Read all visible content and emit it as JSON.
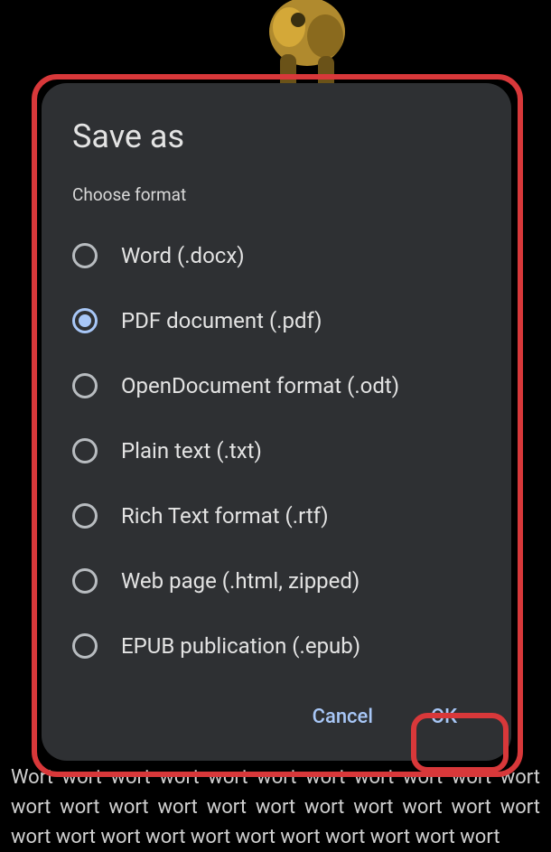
{
  "dialog": {
    "title": "Save as",
    "subtitle": "Choose format",
    "options": [
      {
        "label": "Word (.docx)",
        "selected": false
      },
      {
        "label": "PDF document (.pdf)",
        "selected": true
      },
      {
        "label": "OpenDocument format (.odt)",
        "selected": false
      },
      {
        "label": "Plain text (.txt)",
        "selected": false
      },
      {
        "label": "Rich Text format (.rtf)",
        "selected": false
      },
      {
        "label": "Web page (.html, zipped)",
        "selected": false
      },
      {
        "label": "EPUB publication (.epub)",
        "selected": false
      }
    ],
    "actions": {
      "cancel": "Cancel",
      "ok": "OK"
    }
  },
  "background_text": "Wort wort wort wort wort wort wort wort wort wort wort wort wort wort wort wort wort wort wort wort wort wort wort wort wort wort wort wort wort wort wort wort wort"
}
